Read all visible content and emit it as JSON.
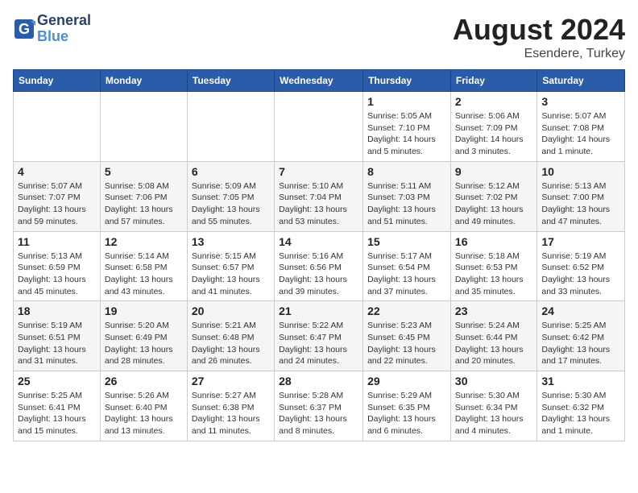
{
  "header": {
    "logo_line1": "General",
    "logo_line2": "Blue",
    "month_year": "August 2024",
    "location": "Esendere, Turkey"
  },
  "weekdays": [
    "Sunday",
    "Monday",
    "Tuesday",
    "Wednesday",
    "Thursday",
    "Friday",
    "Saturday"
  ],
  "weeks": [
    [
      {
        "day": "",
        "info": ""
      },
      {
        "day": "",
        "info": ""
      },
      {
        "day": "",
        "info": ""
      },
      {
        "day": "",
        "info": ""
      },
      {
        "day": "1",
        "info": "Sunrise: 5:05 AM\nSunset: 7:10 PM\nDaylight: 14 hours\nand 5 minutes."
      },
      {
        "day": "2",
        "info": "Sunrise: 5:06 AM\nSunset: 7:09 PM\nDaylight: 14 hours\nand 3 minutes."
      },
      {
        "day": "3",
        "info": "Sunrise: 5:07 AM\nSunset: 7:08 PM\nDaylight: 14 hours\nand 1 minute."
      }
    ],
    [
      {
        "day": "4",
        "info": "Sunrise: 5:07 AM\nSunset: 7:07 PM\nDaylight: 13 hours\nand 59 minutes."
      },
      {
        "day": "5",
        "info": "Sunrise: 5:08 AM\nSunset: 7:06 PM\nDaylight: 13 hours\nand 57 minutes."
      },
      {
        "day": "6",
        "info": "Sunrise: 5:09 AM\nSunset: 7:05 PM\nDaylight: 13 hours\nand 55 minutes."
      },
      {
        "day": "7",
        "info": "Sunrise: 5:10 AM\nSunset: 7:04 PM\nDaylight: 13 hours\nand 53 minutes."
      },
      {
        "day": "8",
        "info": "Sunrise: 5:11 AM\nSunset: 7:03 PM\nDaylight: 13 hours\nand 51 minutes."
      },
      {
        "day": "9",
        "info": "Sunrise: 5:12 AM\nSunset: 7:02 PM\nDaylight: 13 hours\nand 49 minutes."
      },
      {
        "day": "10",
        "info": "Sunrise: 5:13 AM\nSunset: 7:00 PM\nDaylight: 13 hours\nand 47 minutes."
      }
    ],
    [
      {
        "day": "11",
        "info": "Sunrise: 5:13 AM\nSunset: 6:59 PM\nDaylight: 13 hours\nand 45 minutes."
      },
      {
        "day": "12",
        "info": "Sunrise: 5:14 AM\nSunset: 6:58 PM\nDaylight: 13 hours\nand 43 minutes."
      },
      {
        "day": "13",
        "info": "Sunrise: 5:15 AM\nSunset: 6:57 PM\nDaylight: 13 hours\nand 41 minutes."
      },
      {
        "day": "14",
        "info": "Sunrise: 5:16 AM\nSunset: 6:56 PM\nDaylight: 13 hours\nand 39 minutes."
      },
      {
        "day": "15",
        "info": "Sunrise: 5:17 AM\nSunset: 6:54 PM\nDaylight: 13 hours\nand 37 minutes."
      },
      {
        "day": "16",
        "info": "Sunrise: 5:18 AM\nSunset: 6:53 PM\nDaylight: 13 hours\nand 35 minutes."
      },
      {
        "day": "17",
        "info": "Sunrise: 5:19 AM\nSunset: 6:52 PM\nDaylight: 13 hours\nand 33 minutes."
      }
    ],
    [
      {
        "day": "18",
        "info": "Sunrise: 5:19 AM\nSunset: 6:51 PM\nDaylight: 13 hours\nand 31 minutes."
      },
      {
        "day": "19",
        "info": "Sunrise: 5:20 AM\nSunset: 6:49 PM\nDaylight: 13 hours\nand 28 minutes."
      },
      {
        "day": "20",
        "info": "Sunrise: 5:21 AM\nSunset: 6:48 PM\nDaylight: 13 hours\nand 26 minutes."
      },
      {
        "day": "21",
        "info": "Sunrise: 5:22 AM\nSunset: 6:47 PM\nDaylight: 13 hours\nand 24 minutes."
      },
      {
        "day": "22",
        "info": "Sunrise: 5:23 AM\nSunset: 6:45 PM\nDaylight: 13 hours\nand 22 minutes."
      },
      {
        "day": "23",
        "info": "Sunrise: 5:24 AM\nSunset: 6:44 PM\nDaylight: 13 hours\nand 20 minutes."
      },
      {
        "day": "24",
        "info": "Sunrise: 5:25 AM\nSunset: 6:42 PM\nDaylight: 13 hours\nand 17 minutes."
      }
    ],
    [
      {
        "day": "25",
        "info": "Sunrise: 5:25 AM\nSunset: 6:41 PM\nDaylight: 13 hours\nand 15 minutes."
      },
      {
        "day": "26",
        "info": "Sunrise: 5:26 AM\nSunset: 6:40 PM\nDaylight: 13 hours\nand 13 minutes."
      },
      {
        "day": "27",
        "info": "Sunrise: 5:27 AM\nSunset: 6:38 PM\nDaylight: 13 hours\nand 11 minutes."
      },
      {
        "day": "28",
        "info": "Sunrise: 5:28 AM\nSunset: 6:37 PM\nDaylight: 13 hours\nand 8 minutes."
      },
      {
        "day": "29",
        "info": "Sunrise: 5:29 AM\nSunset: 6:35 PM\nDaylight: 13 hours\nand 6 minutes."
      },
      {
        "day": "30",
        "info": "Sunrise: 5:30 AM\nSunset: 6:34 PM\nDaylight: 13 hours\nand 4 minutes."
      },
      {
        "day": "31",
        "info": "Sunrise: 5:30 AM\nSunset: 6:32 PM\nDaylight: 13 hours\nand 1 minute."
      }
    ]
  ]
}
